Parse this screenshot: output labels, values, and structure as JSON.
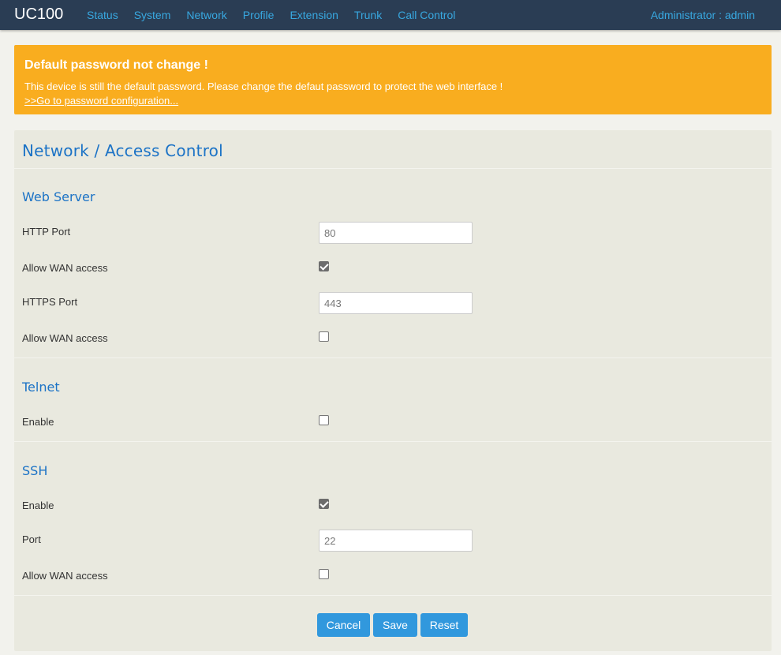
{
  "nav": {
    "brand": "UC100",
    "links": [
      "Status",
      "System",
      "Network",
      "Profile",
      "Extension",
      "Trunk",
      "Call Control"
    ],
    "user": "Administrator : admin"
  },
  "banner": {
    "title": "Default password not change !",
    "text": "This device is still the default password. Please change the defaut password to protect the web interface !",
    "link": ">>Go to password configuration..."
  },
  "page": {
    "title": "Network / Access Control"
  },
  "web_server": {
    "title": "Web Server",
    "http_port_label": "HTTP Port",
    "http_port": "80",
    "http_wan_label": "Allow WAN access",
    "http_wan_checked": true,
    "https_port_label": "HTTPS Port",
    "https_port": "443",
    "https_wan_label": "Allow WAN access",
    "https_wan_checked": false
  },
  "telnet": {
    "title": "Telnet",
    "enable_label": "Enable",
    "enable_checked": false
  },
  "ssh": {
    "title": "SSH",
    "enable_label": "Enable",
    "enable_checked": true,
    "port_label": "Port",
    "port": "22",
    "wan_label": "Allow WAN access",
    "wan_checked": false
  },
  "buttons": {
    "cancel": "Cancel",
    "save": "Save",
    "reset": "Reset"
  },
  "colors": {
    "navbar": "#2a3d54",
    "banner": "#f9ad1f",
    "accent": "#1c73c6",
    "button": "#3198dd"
  }
}
